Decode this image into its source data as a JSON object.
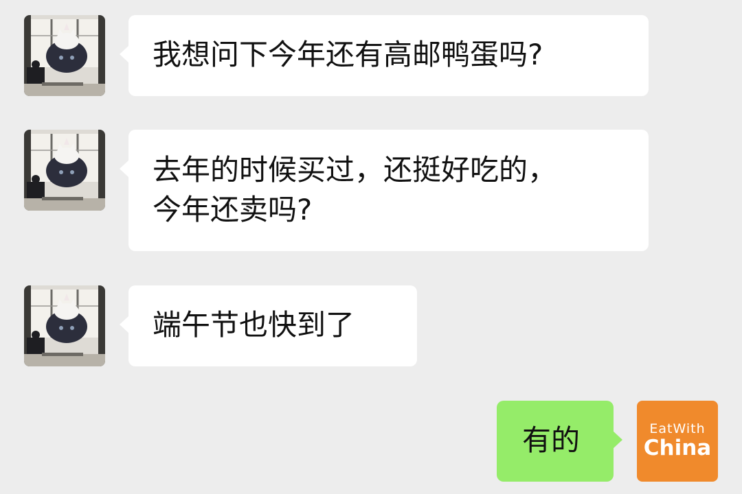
{
  "messages": [
    {
      "sender": "other",
      "text": "我想问下今年还有高邮鸭蛋吗?"
    },
    {
      "sender": "other",
      "text": "去年的时候买过，还挺好吃的，\n今年还卖吗?"
    },
    {
      "sender": "other",
      "text": "端午节也快到了"
    },
    {
      "sender": "self",
      "text": "有的"
    }
  ],
  "self_avatar": {
    "line1": "EatWith",
    "line2": "China",
    "color": "#f08a2c"
  },
  "colors": {
    "background": "#ededed",
    "incoming_bubble": "#ffffff",
    "outgoing_bubble": "#95ec69"
  },
  "icons": {
    "other_avatar": "cat-illustration-avatar"
  }
}
